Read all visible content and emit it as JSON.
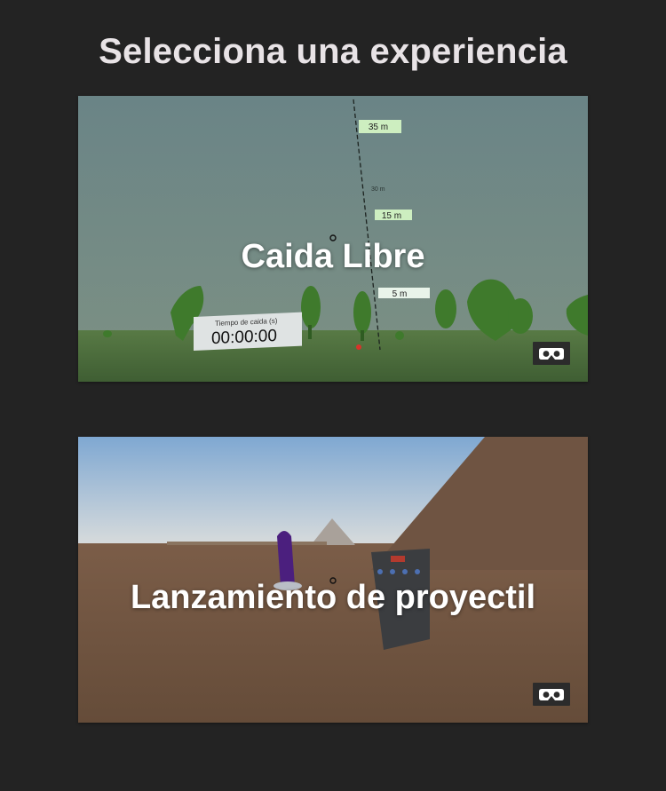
{
  "page": {
    "title": "Selecciona una experiencia"
  },
  "experiences": [
    {
      "label": "Caida Libre",
      "scene": {
        "height_markers": [
          "35 m",
          "15 m",
          "5 m"
        ],
        "tick_labels": [
          "30 m"
        ],
        "timer_title": "Tiempo de caida (s)",
        "timer_value": "00:00:00"
      },
      "vr_icon": "vr-goggles-icon"
    },
    {
      "label": "Lanzamiento de proyectil",
      "vr_icon": "vr-goggles-icon"
    }
  ],
  "colors": {
    "background": "#232323",
    "title": "#e8e3e6",
    "sky_caida": "#6b8587",
    "ground_caida": "#4d6b3c",
    "sky_proyectil": "#8fb4db",
    "ground_proyectil": "#6e5441"
  }
}
